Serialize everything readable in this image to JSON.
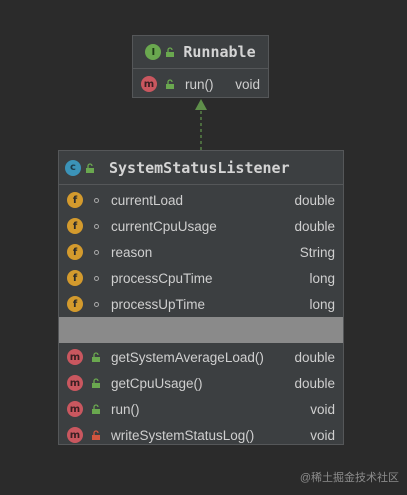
{
  "interface_box": {
    "badge": "I",
    "title": "Runnable",
    "methods": [
      {
        "badge": "m",
        "name": "run()",
        "type": "void",
        "visibility": "public-lock-icon"
      }
    ]
  },
  "class_box": {
    "badge": "c",
    "title": "SystemStatusListener",
    "fields": [
      {
        "badge": "f",
        "name": "currentLoad",
        "type": "double",
        "visibility": "package-dot-icon"
      },
      {
        "badge": "f",
        "name": "currentCpuUsage",
        "type": "double",
        "visibility": "package-dot-icon"
      },
      {
        "badge": "f",
        "name": "reason",
        "type": "String",
        "visibility": "package-dot-icon"
      },
      {
        "badge": "f",
        "name": "processCpuTime",
        "type": "long",
        "visibility": "package-dot-icon"
      },
      {
        "badge": "f",
        "name": "processUpTime",
        "type": "long",
        "visibility": "package-dot-icon"
      }
    ],
    "methods": [
      {
        "badge": "m",
        "name": "getSystemAverageLoad()",
        "type": "double",
        "visibility": "public-lock-icon"
      },
      {
        "badge": "m",
        "name": "getCpuUsage()",
        "type": "double",
        "visibility": "public-lock-icon"
      },
      {
        "badge": "m",
        "name": "run()",
        "type": "void",
        "visibility": "public-lock-icon"
      },
      {
        "badge": "m",
        "name": "writeSystemStatusLog()",
        "type": "void",
        "visibility": "private-lock-icon"
      }
    ]
  },
  "colors": {
    "background": "#2b2b2b",
    "box": "#3c3f41",
    "arrow": "#5f8f4a",
    "public": "#6aa84f",
    "private": "#d0553f"
  },
  "watermark": "@稀土掘金技术社区"
}
